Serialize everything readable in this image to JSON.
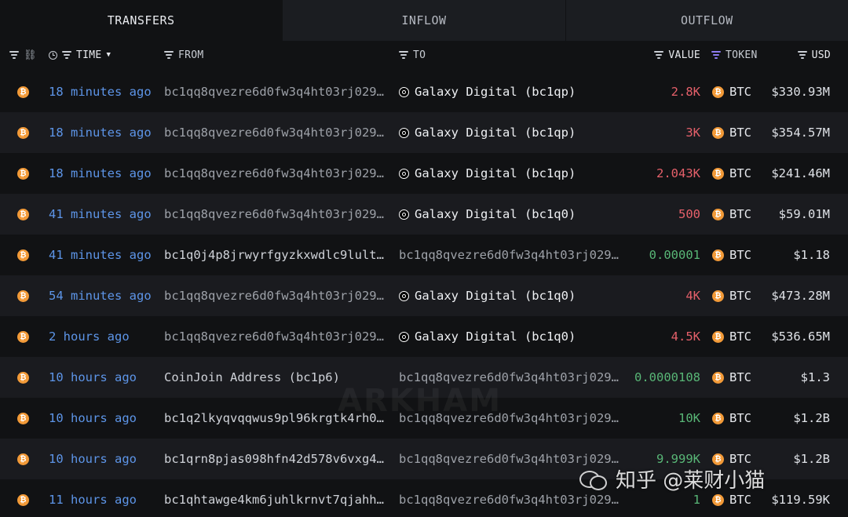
{
  "tabs": [
    {
      "label": "TRANSFERS",
      "active": true
    },
    {
      "label": "INFLOW",
      "active": false
    },
    {
      "label": "OUTFLOW",
      "active": false
    }
  ],
  "header": {
    "time": "TIME",
    "from": "FROM",
    "to": "TO",
    "value": "VALUE",
    "token": "TOKEN",
    "usd": "USD"
  },
  "colors": {
    "time_link": "#5d95e8",
    "value_out": "#e5606a",
    "value_in": "#58b676",
    "coin": "#f29a38",
    "token_filter": "#8d7bf0"
  },
  "rows": [
    {
      "time": "18 minutes ago",
      "from": "bc1qq8qvezre6d0fw3q4ht03rj029…",
      "to": "Galaxy Digital (bc1qp)",
      "to_entity": true,
      "value": "2.8K",
      "dir": "out",
      "token": "BTC",
      "usd": "$330.93M"
    },
    {
      "time": "18 minutes ago",
      "from": "bc1qq8qvezre6d0fw3q4ht03rj029…",
      "to": "Galaxy Digital (bc1qp)",
      "to_entity": true,
      "value": "3K",
      "dir": "out",
      "token": "BTC",
      "usd": "$354.57M"
    },
    {
      "time": "18 minutes ago",
      "from": "bc1qq8qvezre6d0fw3q4ht03rj029…",
      "to": "Galaxy Digital (bc1qp)",
      "to_entity": true,
      "value": "2.043K",
      "dir": "out",
      "token": "BTC",
      "usd": "$241.46M"
    },
    {
      "time": "41 minutes ago",
      "from": "bc1qq8qvezre6d0fw3q4ht03rj029…",
      "to": "Galaxy Digital (bc1q0)",
      "to_entity": true,
      "value": "500",
      "dir": "out",
      "token": "BTC",
      "usd": "$59.01M"
    },
    {
      "time": "41 minutes ago",
      "from": "bc1q0j4p8jrwyrfgyzkxwdlc9lult…",
      "from_bright": true,
      "to": "bc1qq8qvezre6d0fw3q4ht03rj029…",
      "to_entity": false,
      "value": "0.00001",
      "dir": "in",
      "token": "BTC",
      "usd": "$1.18"
    },
    {
      "time": "54 minutes ago",
      "from": "bc1qq8qvezre6d0fw3q4ht03rj029…",
      "to": "Galaxy Digital (bc1q0)",
      "to_entity": true,
      "value": "4K",
      "dir": "out",
      "token": "BTC",
      "usd": "$473.28M"
    },
    {
      "time": "2 hours ago",
      "from": "bc1qq8qvezre6d0fw3q4ht03rj029…",
      "to": "Galaxy Digital (bc1q0)",
      "to_entity": true,
      "value": "4.5K",
      "dir": "out",
      "token": "BTC",
      "usd": "$536.65M"
    },
    {
      "time": "10 hours ago",
      "from": "CoinJoin Address (bc1p6)",
      "from_bright": true,
      "to": "bc1qq8qvezre6d0fw3q4ht03rj029…",
      "to_entity": false,
      "value": "0.0000108",
      "dir": "in",
      "token": "BTC",
      "usd": "$1.3"
    },
    {
      "time": "10 hours ago",
      "from": "bc1q2lkyqvqqwus9pl96krgtk4rh0…",
      "from_bright": true,
      "to": "bc1qq8qvezre6d0fw3q4ht03rj029…",
      "to_entity": false,
      "value": "10K",
      "dir": "in",
      "token": "BTC",
      "usd": "$1.2B"
    },
    {
      "time": "10 hours ago",
      "from": "bc1qrn8pjas098hfn42d578v6vxg4…",
      "from_bright": true,
      "to": "bc1qq8qvezre6d0fw3q4ht03rj029…",
      "to_entity": false,
      "value": "9.999K",
      "dir": "in",
      "token": "BTC",
      "usd": "$1.2B"
    },
    {
      "time": "11 hours ago",
      "from": "bc1qhtawge4km6juhlkrnvt7qjahh…",
      "from_bright": true,
      "to": "bc1qq8qvezre6d0fw3q4ht03rj029…",
      "to_entity": false,
      "value": "1",
      "dir": "in",
      "token": "BTC",
      "usd": "$119.59K"
    }
  ],
  "watermarks": {
    "arkham": "ARKHAM",
    "zhihu": "知乎 @莱财小猫"
  }
}
